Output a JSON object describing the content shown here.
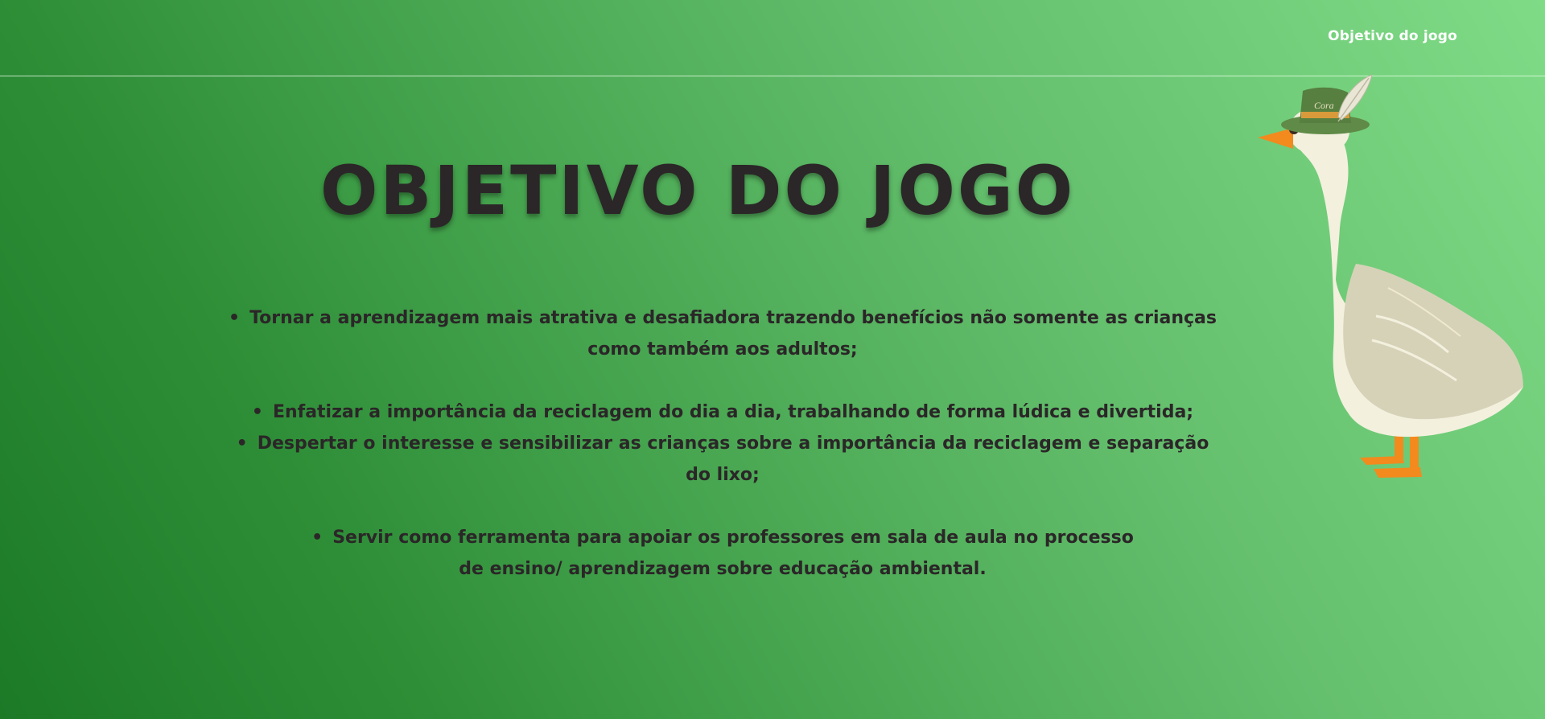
{
  "nav": {
    "link_label": "Objetivo do jogo"
  },
  "main": {
    "title": "OBJETIVO DO JOGO",
    "objectives": [
      "Tornar a aprendizagem mais atrativa e desafiadora trazendo benefícios não somente as crianças como também aos adultos;",
      "Enfatizar a importância da reciclagem do dia a dia, trabalhando de forma lúdica e divertida;",
      "Despertar o interesse e sensibilizar as crianças sobre a importância da reciclagem e separação do lixo;",
      "Servir como ferramenta para apoiar os professores em sala de aula no processo de ensino/ aprendizagem sobre educação ambiental."
    ],
    "bullet": "•"
  },
  "illustration": {
    "name": "goose-with-hat-icon",
    "hat_text": "Cora"
  },
  "colors": {
    "background_dark": "#1c7a27",
    "background_light": "#7fdb86",
    "text_dark": "#2b2628",
    "nav_text": "#ffffff",
    "goose_body": "#f3f0de",
    "goose_wing": "#d6d2b8",
    "beak_feet": "#f28a1e",
    "hat_green": "#5f8a47",
    "hat_band": "#d89a3a"
  }
}
